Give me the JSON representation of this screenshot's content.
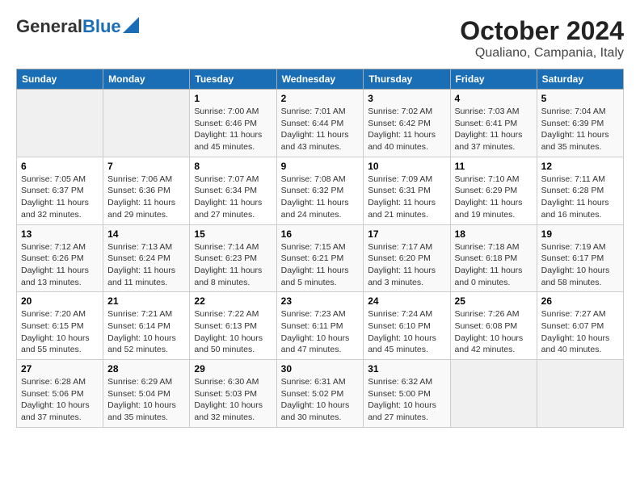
{
  "logo": {
    "general": "General",
    "blue": "Blue"
  },
  "title": "October 2024",
  "subtitle": "Qualiano, Campania, Italy",
  "days_of_week": [
    "Sunday",
    "Monday",
    "Tuesday",
    "Wednesday",
    "Thursday",
    "Friday",
    "Saturday"
  ],
  "weeks": [
    [
      {
        "day": "",
        "info": ""
      },
      {
        "day": "",
        "info": ""
      },
      {
        "day": "1",
        "sunrise": "Sunrise: 7:00 AM",
        "sunset": "Sunset: 6:46 PM",
        "daylight": "Daylight: 11 hours and 45 minutes."
      },
      {
        "day": "2",
        "sunrise": "Sunrise: 7:01 AM",
        "sunset": "Sunset: 6:44 PM",
        "daylight": "Daylight: 11 hours and 43 minutes."
      },
      {
        "day": "3",
        "sunrise": "Sunrise: 7:02 AM",
        "sunset": "Sunset: 6:42 PM",
        "daylight": "Daylight: 11 hours and 40 minutes."
      },
      {
        "day": "4",
        "sunrise": "Sunrise: 7:03 AM",
        "sunset": "Sunset: 6:41 PM",
        "daylight": "Daylight: 11 hours and 37 minutes."
      },
      {
        "day": "5",
        "sunrise": "Sunrise: 7:04 AM",
        "sunset": "Sunset: 6:39 PM",
        "daylight": "Daylight: 11 hours and 35 minutes."
      }
    ],
    [
      {
        "day": "6",
        "sunrise": "Sunrise: 7:05 AM",
        "sunset": "Sunset: 6:37 PM",
        "daylight": "Daylight: 11 hours and 32 minutes."
      },
      {
        "day": "7",
        "sunrise": "Sunrise: 7:06 AM",
        "sunset": "Sunset: 6:36 PM",
        "daylight": "Daylight: 11 hours and 29 minutes."
      },
      {
        "day": "8",
        "sunrise": "Sunrise: 7:07 AM",
        "sunset": "Sunset: 6:34 PM",
        "daylight": "Daylight: 11 hours and 27 minutes."
      },
      {
        "day": "9",
        "sunrise": "Sunrise: 7:08 AM",
        "sunset": "Sunset: 6:32 PM",
        "daylight": "Daylight: 11 hours and 24 minutes."
      },
      {
        "day": "10",
        "sunrise": "Sunrise: 7:09 AM",
        "sunset": "Sunset: 6:31 PM",
        "daylight": "Daylight: 11 hours and 21 minutes."
      },
      {
        "day": "11",
        "sunrise": "Sunrise: 7:10 AM",
        "sunset": "Sunset: 6:29 PM",
        "daylight": "Daylight: 11 hours and 19 minutes."
      },
      {
        "day": "12",
        "sunrise": "Sunrise: 7:11 AM",
        "sunset": "Sunset: 6:28 PM",
        "daylight": "Daylight: 11 hours and 16 minutes."
      }
    ],
    [
      {
        "day": "13",
        "sunrise": "Sunrise: 7:12 AM",
        "sunset": "Sunset: 6:26 PM",
        "daylight": "Daylight: 11 hours and 13 minutes."
      },
      {
        "day": "14",
        "sunrise": "Sunrise: 7:13 AM",
        "sunset": "Sunset: 6:24 PM",
        "daylight": "Daylight: 11 hours and 11 minutes."
      },
      {
        "day": "15",
        "sunrise": "Sunrise: 7:14 AM",
        "sunset": "Sunset: 6:23 PM",
        "daylight": "Daylight: 11 hours and 8 minutes."
      },
      {
        "day": "16",
        "sunrise": "Sunrise: 7:15 AM",
        "sunset": "Sunset: 6:21 PM",
        "daylight": "Daylight: 11 hours and 5 minutes."
      },
      {
        "day": "17",
        "sunrise": "Sunrise: 7:17 AM",
        "sunset": "Sunset: 6:20 PM",
        "daylight": "Daylight: 11 hours and 3 minutes."
      },
      {
        "day": "18",
        "sunrise": "Sunrise: 7:18 AM",
        "sunset": "Sunset: 6:18 PM",
        "daylight": "Daylight: 11 hours and 0 minutes."
      },
      {
        "day": "19",
        "sunrise": "Sunrise: 7:19 AM",
        "sunset": "Sunset: 6:17 PM",
        "daylight": "Daylight: 10 hours and 58 minutes."
      }
    ],
    [
      {
        "day": "20",
        "sunrise": "Sunrise: 7:20 AM",
        "sunset": "Sunset: 6:15 PM",
        "daylight": "Daylight: 10 hours and 55 minutes."
      },
      {
        "day": "21",
        "sunrise": "Sunrise: 7:21 AM",
        "sunset": "Sunset: 6:14 PM",
        "daylight": "Daylight: 10 hours and 52 minutes."
      },
      {
        "day": "22",
        "sunrise": "Sunrise: 7:22 AM",
        "sunset": "Sunset: 6:13 PM",
        "daylight": "Daylight: 10 hours and 50 minutes."
      },
      {
        "day": "23",
        "sunrise": "Sunrise: 7:23 AM",
        "sunset": "Sunset: 6:11 PM",
        "daylight": "Daylight: 10 hours and 47 minutes."
      },
      {
        "day": "24",
        "sunrise": "Sunrise: 7:24 AM",
        "sunset": "Sunset: 6:10 PM",
        "daylight": "Daylight: 10 hours and 45 minutes."
      },
      {
        "day": "25",
        "sunrise": "Sunrise: 7:26 AM",
        "sunset": "Sunset: 6:08 PM",
        "daylight": "Daylight: 10 hours and 42 minutes."
      },
      {
        "day": "26",
        "sunrise": "Sunrise: 7:27 AM",
        "sunset": "Sunset: 6:07 PM",
        "daylight": "Daylight: 10 hours and 40 minutes."
      }
    ],
    [
      {
        "day": "27",
        "sunrise": "Sunrise: 6:28 AM",
        "sunset": "Sunset: 5:06 PM",
        "daylight": "Daylight: 10 hours and 37 minutes."
      },
      {
        "day": "28",
        "sunrise": "Sunrise: 6:29 AM",
        "sunset": "Sunset: 5:04 PM",
        "daylight": "Daylight: 10 hours and 35 minutes."
      },
      {
        "day": "29",
        "sunrise": "Sunrise: 6:30 AM",
        "sunset": "Sunset: 5:03 PM",
        "daylight": "Daylight: 10 hours and 32 minutes."
      },
      {
        "day": "30",
        "sunrise": "Sunrise: 6:31 AM",
        "sunset": "Sunset: 5:02 PM",
        "daylight": "Daylight: 10 hours and 30 minutes."
      },
      {
        "day": "31",
        "sunrise": "Sunrise: 6:32 AM",
        "sunset": "Sunset: 5:00 PM",
        "daylight": "Daylight: 10 hours and 27 minutes."
      },
      {
        "day": "",
        "info": ""
      },
      {
        "day": "",
        "info": ""
      }
    ]
  ]
}
